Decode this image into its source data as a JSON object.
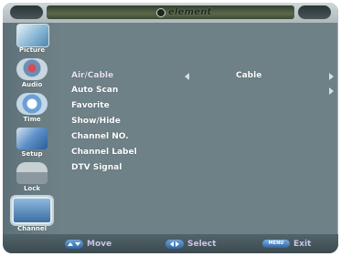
{
  "brand": {
    "name": "element"
  },
  "sidebar": {
    "items": [
      {
        "label": "Picture",
        "icon": "picture-icon"
      },
      {
        "label": "Audio",
        "icon": "speaker-icon"
      },
      {
        "label": "Time",
        "icon": "clock-icon"
      },
      {
        "label": "Setup",
        "icon": "setup-icon"
      },
      {
        "label": "Lock",
        "icon": "lock-icon"
      },
      {
        "label": "Channel",
        "icon": "tv-icon",
        "active": true
      }
    ]
  },
  "menu": {
    "items": [
      {
        "label": "Air/Cable",
        "value": "Cable"
      },
      {
        "label": "Auto Scan"
      },
      {
        "label": "Favorite"
      },
      {
        "label": "Show/Hide"
      },
      {
        "label": "Channel NO."
      },
      {
        "label": "Channel Label"
      },
      {
        "label": "DTV  Signal"
      }
    ]
  },
  "bottombar": {
    "move": "Move",
    "select": "Select",
    "menu_key": "MENU",
    "exit": "Exit"
  },
  "colors": {
    "panel": "#6e8187",
    "text": "#ffffff",
    "hint_text": "#c9c4e8",
    "key_blue": "#2f66a3"
  }
}
